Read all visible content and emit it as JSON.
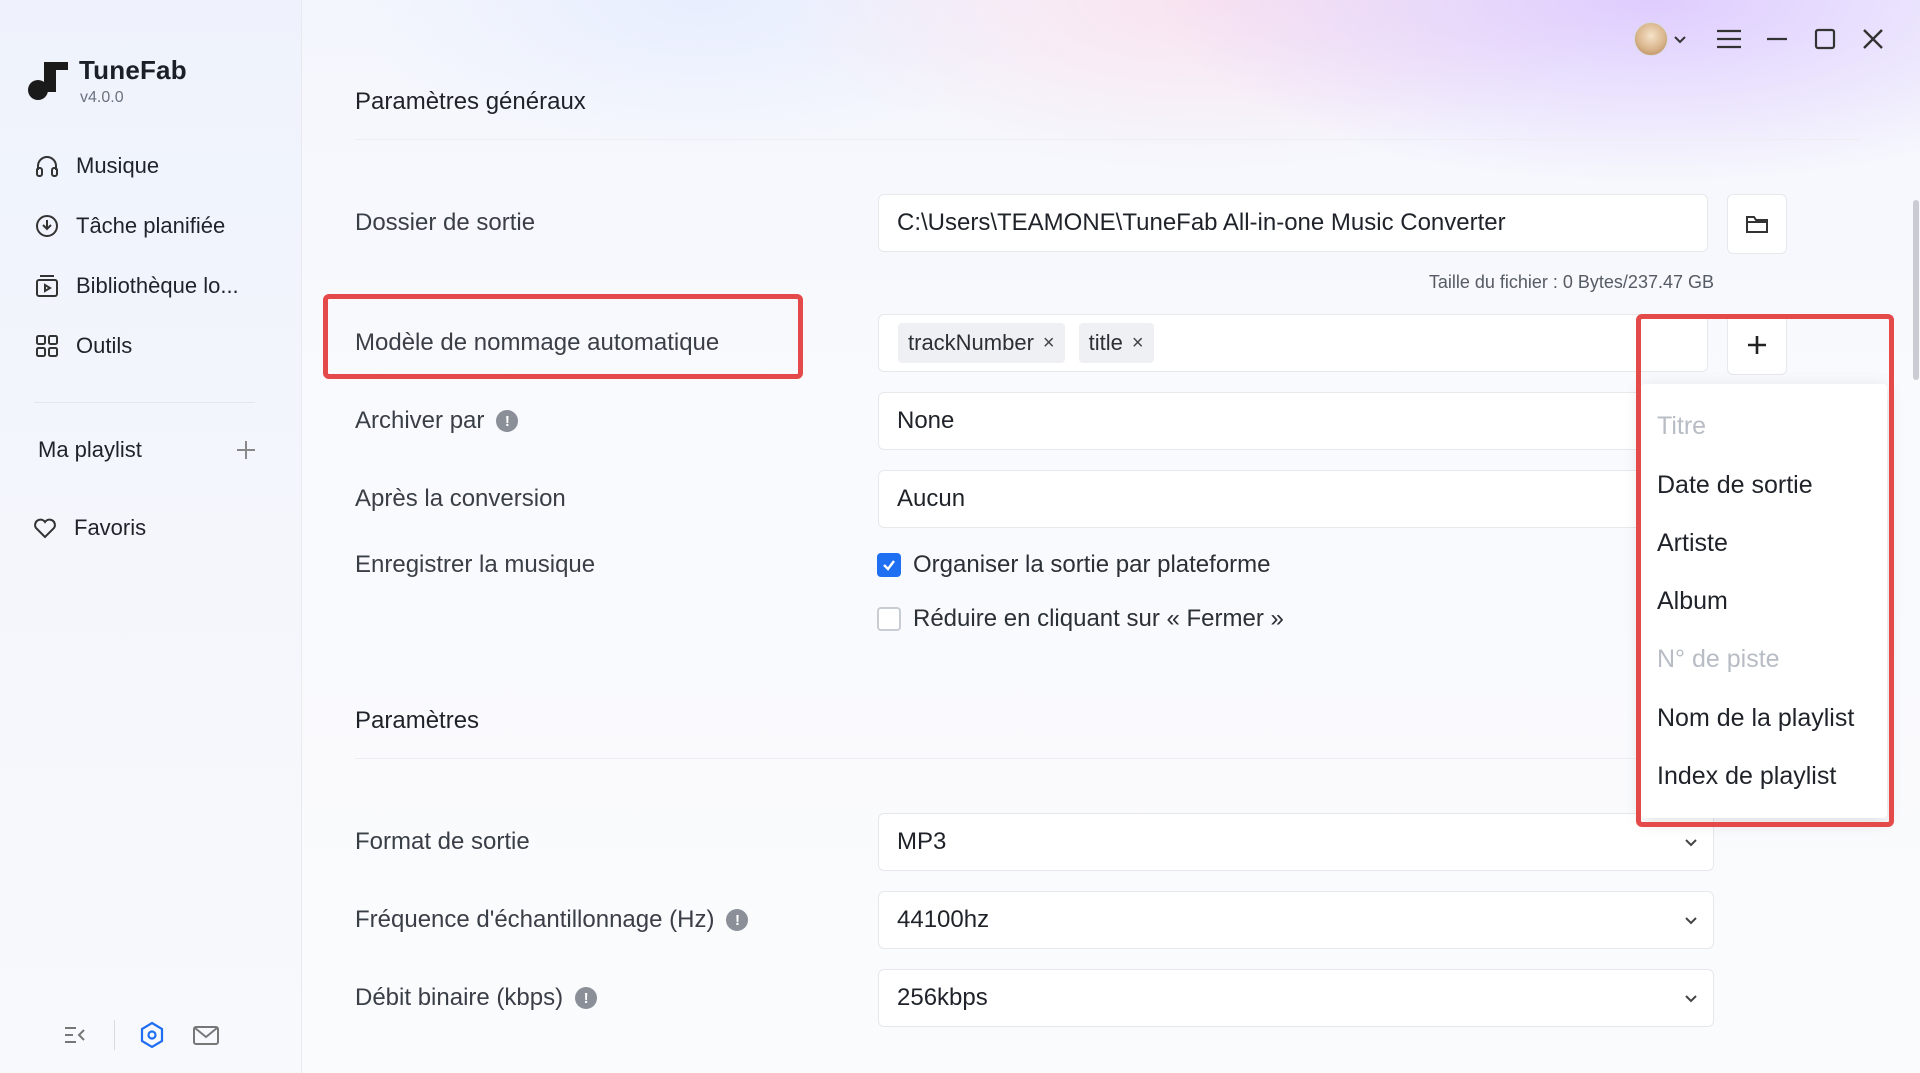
{
  "app": {
    "name": "TuneFab",
    "version": "v4.0.0"
  },
  "sidebar": {
    "items": [
      {
        "label": "Musique",
        "icon": "headphones-icon"
      },
      {
        "label": "Tâche planifiée",
        "icon": "download-clock-icon"
      },
      {
        "label": "Bibliothèque lo...",
        "icon": "library-icon"
      },
      {
        "label": "Outils",
        "icon": "grid-icon"
      }
    ],
    "playlist_label": "Ma playlist",
    "favorites_label": "Favoris"
  },
  "general": {
    "title": "Paramètres généraux",
    "output_folder_label": "Dossier de sortie",
    "output_folder_value": "C:\\Users\\TEAMONE\\TuneFab All-in-one Music Converter",
    "file_size": "Taille du fichier : 0 Bytes/237.47 GB",
    "naming_label": "Modèle de nommage automatique",
    "naming_tags": [
      "trackNumber",
      "title"
    ],
    "archive_label": "Archiver par",
    "archive_value": "None",
    "after_conversion_label": "Après la conversion",
    "after_conversion_value": "Aucun",
    "save_music_label": "Enregistrer la musique",
    "organize_label": "Organiser la sortie par plateforme",
    "organize_checked": true,
    "minimize_label": "Réduire en cliquant sur « Fermer »",
    "minimize_checked": false
  },
  "params": {
    "title": "Paramètres",
    "format_label": "Format de sortie",
    "format_value": "MP3",
    "sample_rate_label": "Fréquence d'échantillonnage (Hz)",
    "sample_rate_value": "44100hz",
    "bitrate_label": "Débit binaire (kbps)",
    "bitrate_value": "256kbps"
  },
  "dropdown": {
    "items": [
      {
        "label": "Titre",
        "disabled": true
      },
      {
        "label": "Date de sortie",
        "disabled": false
      },
      {
        "label": "Artiste",
        "disabled": false
      },
      {
        "label": "Album",
        "disabled": false
      },
      {
        "label": "N° de piste",
        "disabled": true
      },
      {
        "label": "Nom de la playlist",
        "disabled": false
      },
      {
        "label": "Index de playlist",
        "disabled": false
      }
    ]
  },
  "colors": {
    "accent": "#1e6ff1",
    "highlight": "#e44a4a"
  }
}
